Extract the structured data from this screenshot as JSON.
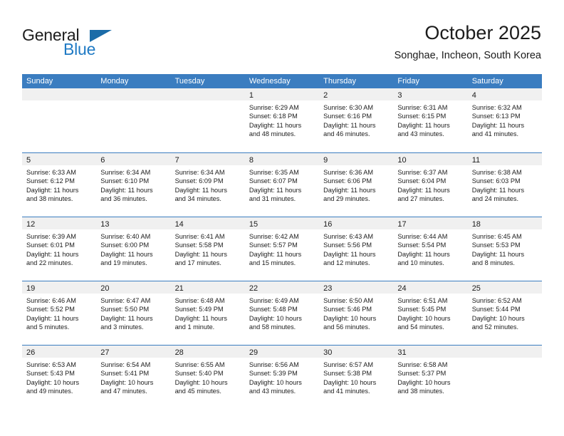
{
  "brand": {
    "name_top": "General",
    "name_bottom": "Blue",
    "flag_icon": "triangle-flag-icon",
    "accent_color": "#1f7ac4",
    "header_color": "#3b7dc0"
  },
  "header": {
    "title": "October 2025",
    "location": "Songhae, Incheon, South Korea"
  },
  "calendar": {
    "weekday_headers": [
      "Sunday",
      "Monday",
      "Tuesday",
      "Wednesday",
      "Thursday",
      "Friday",
      "Saturday"
    ],
    "labels": {
      "sunrise": "Sunrise:",
      "sunset": "Sunset:",
      "daylight": "Daylight:"
    },
    "weeks": [
      [
        {
          "day": "",
          "sunrise": "",
          "sunset": "",
          "daylight_1": "",
          "daylight_2": ""
        },
        {
          "day": "",
          "sunrise": "",
          "sunset": "",
          "daylight_1": "",
          "daylight_2": ""
        },
        {
          "day": "",
          "sunrise": "",
          "sunset": "",
          "daylight_1": "",
          "daylight_2": ""
        },
        {
          "day": "1",
          "sunrise": "Sunrise: 6:29 AM",
          "sunset": "Sunset: 6:18 PM",
          "daylight_1": "Daylight: 11 hours",
          "daylight_2": "and 48 minutes."
        },
        {
          "day": "2",
          "sunrise": "Sunrise: 6:30 AM",
          "sunset": "Sunset: 6:16 PM",
          "daylight_1": "Daylight: 11 hours",
          "daylight_2": "and 46 minutes."
        },
        {
          "day": "3",
          "sunrise": "Sunrise: 6:31 AM",
          "sunset": "Sunset: 6:15 PM",
          "daylight_1": "Daylight: 11 hours",
          "daylight_2": "and 43 minutes."
        },
        {
          "day": "4",
          "sunrise": "Sunrise: 6:32 AM",
          "sunset": "Sunset: 6:13 PM",
          "daylight_1": "Daylight: 11 hours",
          "daylight_2": "and 41 minutes."
        }
      ],
      [
        {
          "day": "5",
          "sunrise": "Sunrise: 6:33 AM",
          "sunset": "Sunset: 6:12 PM",
          "daylight_1": "Daylight: 11 hours",
          "daylight_2": "and 38 minutes."
        },
        {
          "day": "6",
          "sunrise": "Sunrise: 6:34 AM",
          "sunset": "Sunset: 6:10 PM",
          "daylight_1": "Daylight: 11 hours",
          "daylight_2": "and 36 minutes."
        },
        {
          "day": "7",
          "sunrise": "Sunrise: 6:34 AM",
          "sunset": "Sunset: 6:09 PM",
          "daylight_1": "Daylight: 11 hours",
          "daylight_2": "and 34 minutes."
        },
        {
          "day": "8",
          "sunrise": "Sunrise: 6:35 AM",
          "sunset": "Sunset: 6:07 PM",
          "daylight_1": "Daylight: 11 hours",
          "daylight_2": "and 31 minutes."
        },
        {
          "day": "9",
          "sunrise": "Sunrise: 6:36 AM",
          "sunset": "Sunset: 6:06 PM",
          "daylight_1": "Daylight: 11 hours",
          "daylight_2": "and 29 minutes."
        },
        {
          "day": "10",
          "sunrise": "Sunrise: 6:37 AM",
          "sunset": "Sunset: 6:04 PM",
          "daylight_1": "Daylight: 11 hours",
          "daylight_2": "and 27 minutes."
        },
        {
          "day": "11",
          "sunrise": "Sunrise: 6:38 AM",
          "sunset": "Sunset: 6:03 PM",
          "daylight_1": "Daylight: 11 hours",
          "daylight_2": "and 24 minutes."
        }
      ],
      [
        {
          "day": "12",
          "sunrise": "Sunrise: 6:39 AM",
          "sunset": "Sunset: 6:01 PM",
          "daylight_1": "Daylight: 11 hours",
          "daylight_2": "and 22 minutes."
        },
        {
          "day": "13",
          "sunrise": "Sunrise: 6:40 AM",
          "sunset": "Sunset: 6:00 PM",
          "daylight_1": "Daylight: 11 hours",
          "daylight_2": "and 19 minutes."
        },
        {
          "day": "14",
          "sunrise": "Sunrise: 6:41 AM",
          "sunset": "Sunset: 5:58 PM",
          "daylight_1": "Daylight: 11 hours",
          "daylight_2": "and 17 minutes."
        },
        {
          "day": "15",
          "sunrise": "Sunrise: 6:42 AM",
          "sunset": "Sunset: 5:57 PM",
          "daylight_1": "Daylight: 11 hours",
          "daylight_2": "and 15 minutes."
        },
        {
          "day": "16",
          "sunrise": "Sunrise: 6:43 AM",
          "sunset": "Sunset: 5:56 PM",
          "daylight_1": "Daylight: 11 hours",
          "daylight_2": "and 12 minutes."
        },
        {
          "day": "17",
          "sunrise": "Sunrise: 6:44 AM",
          "sunset": "Sunset: 5:54 PM",
          "daylight_1": "Daylight: 11 hours",
          "daylight_2": "and 10 minutes."
        },
        {
          "day": "18",
          "sunrise": "Sunrise: 6:45 AM",
          "sunset": "Sunset: 5:53 PM",
          "daylight_1": "Daylight: 11 hours",
          "daylight_2": "and 8 minutes."
        }
      ],
      [
        {
          "day": "19",
          "sunrise": "Sunrise: 6:46 AM",
          "sunset": "Sunset: 5:52 PM",
          "daylight_1": "Daylight: 11 hours",
          "daylight_2": "and 5 minutes."
        },
        {
          "day": "20",
          "sunrise": "Sunrise: 6:47 AM",
          "sunset": "Sunset: 5:50 PM",
          "daylight_1": "Daylight: 11 hours",
          "daylight_2": "and 3 minutes."
        },
        {
          "day": "21",
          "sunrise": "Sunrise: 6:48 AM",
          "sunset": "Sunset: 5:49 PM",
          "daylight_1": "Daylight: 11 hours",
          "daylight_2": "and 1 minute."
        },
        {
          "day": "22",
          "sunrise": "Sunrise: 6:49 AM",
          "sunset": "Sunset: 5:48 PM",
          "daylight_1": "Daylight: 10 hours",
          "daylight_2": "and 58 minutes."
        },
        {
          "day": "23",
          "sunrise": "Sunrise: 6:50 AM",
          "sunset": "Sunset: 5:46 PM",
          "daylight_1": "Daylight: 10 hours",
          "daylight_2": "and 56 minutes."
        },
        {
          "day": "24",
          "sunrise": "Sunrise: 6:51 AM",
          "sunset": "Sunset: 5:45 PM",
          "daylight_1": "Daylight: 10 hours",
          "daylight_2": "and 54 minutes."
        },
        {
          "day": "25",
          "sunrise": "Sunrise: 6:52 AM",
          "sunset": "Sunset: 5:44 PM",
          "daylight_1": "Daylight: 10 hours",
          "daylight_2": "and 52 minutes."
        }
      ],
      [
        {
          "day": "26",
          "sunrise": "Sunrise: 6:53 AM",
          "sunset": "Sunset: 5:43 PM",
          "daylight_1": "Daylight: 10 hours",
          "daylight_2": "and 49 minutes."
        },
        {
          "day": "27",
          "sunrise": "Sunrise: 6:54 AM",
          "sunset": "Sunset: 5:41 PM",
          "daylight_1": "Daylight: 10 hours",
          "daylight_2": "and 47 minutes."
        },
        {
          "day": "28",
          "sunrise": "Sunrise: 6:55 AM",
          "sunset": "Sunset: 5:40 PM",
          "daylight_1": "Daylight: 10 hours",
          "daylight_2": "and 45 minutes."
        },
        {
          "day": "29",
          "sunrise": "Sunrise: 6:56 AM",
          "sunset": "Sunset: 5:39 PM",
          "daylight_1": "Daylight: 10 hours",
          "daylight_2": "and 43 minutes."
        },
        {
          "day": "30",
          "sunrise": "Sunrise: 6:57 AM",
          "sunset": "Sunset: 5:38 PM",
          "daylight_1": "Daylight: 10 hours",
          "daylight_2": "and 41 minutes."
        },
        {
          "day": "31",
          "sunrise": "Sunrise: 6:58 AM",
          "sunset": "Sunset: 5:37 PM",
          "daylight_1": "Daylight: 10 hours",
          "daylight_2": "and 38 minutes."
        },
        {
          "day": "",
          "sunrise": "",
          "sunset": "",
          "daylight_1": "",
          "daylight_2": ""
        }
      ]
    ]
  }
}
